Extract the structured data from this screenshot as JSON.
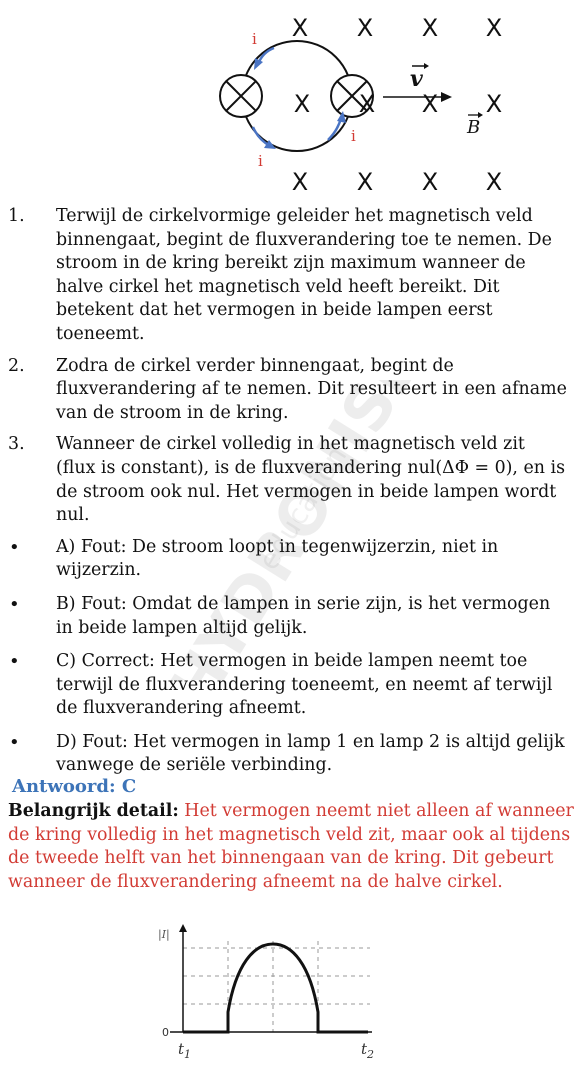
{
  "top_diagram": {
    "field_marks": [
      "X",
      "X",
      "X",
      "X",
      "X",
      "X",
      "X",
      "X",
      "X",
      "X",
      "X",
      "X",
      "X"
    ],
    "current_labels": [
      "i",
      "i",
      "i"
    ],
    "velocity_label": "v",
    "field_label": "B"
  },
  "items": [
    {
      "marker": "1.",
      "text": "Terwijl de cirkelvormige geleider het magnetisch veld binnengaat, begint de fluxverandering toe te nemen. De stroom in de kring bereikt zijn maximum wanneer de halve cirkel het magnetisch veld heeft bereikt. Dit betekent dat het vermogen in beide lampen eerst toeneemt."
    },
    {
      "marker": "2.",
      "text": "Zodra de cirkel verder binnengaat, begint de fluxverandering af te nemen. Dit resulteert in een afname van de stroom in de kring."
    },
    {
      "marker": "3.",
      "text": "Wanneer de cirkel volledig in het magnetisch veld zit (flux is constant), is de fluxverandering nul(ΔΦ = 0), en is de stroom ook nul. Het vermogen in beide lampen wordt nul."
    },
    {
      "marker": "•",
      "text": "A) Fout: De stroom loopt in tegenwijzerzin, niet in wijzerzin."
    },
    {
      "marker": "•",
      "text": "B) Fout: Omdat de lampen in serie zijn, is het vermogen in beide lampen altijd gelijk."
    },
    {
      "marker": "•",
      "text": "C) Correct: Het vermogen in beide lampen neemt toe terwijl de fluxverandering toeneemt, en neemt af terwijl de fluxverandering afneemt."
    },
    {
      "marker": "•",
      "text": "D) Fout: Het vermogen in lamp 1 en lamp 2 is altijd gelijk vanwege de seriële verbinding."
    }
  ],
  "answer": "Antwoord: C",
  "detail": {
    "lead": "Belangrijk detail:",
    "text": " Het vermogen neemt niet alleen af wanneer de kring volledig in het magnetisch veld zit, maar ook al tijdens de tweede helft van het binnengaan van de kring. Dit gebeurt wanneer de fluxverandering afneemt na de halve cirkel."
  },
  "graph": {
    "y_label": "|I|",
    "zero_label": "0",
    "t1_label": "t",
    "t1_sub": "1",
    "t2_label": "t",
    "t2_sub": "2"
  },
  "watermark": {
    "big": "HYDRONISE",
    "small": "education"
  }
}
